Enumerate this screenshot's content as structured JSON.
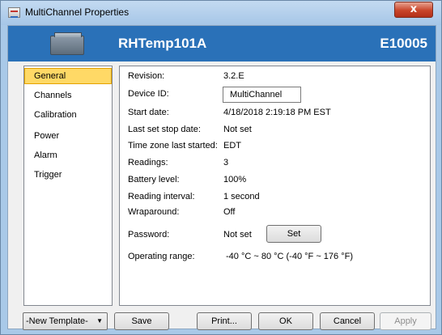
{
  "window": {
    "title": "MultiChannel Properties",
    "close_glyph": "x"
  },
  "header": {
    "device_name": "RHTemp101A",
    "serial": "E10005",
    "band_color": "#2a71b8"
  },
  "nav": {
    "items": [
      {
        "label": "General",
        "selected": true
      },
      {
        "label": "Channels",
        "selected": false
      },
      {
        "label": "Calibration",
        "selected": false
      },
      {
        "label": "Power",
        "selected": false
      },
      {
        "label": "Alarm",
        "selected": false
      },
      {
        "label": "Trigger",
        "selected": false
      }
    ],
    "selected_color": "#ffd966"
  },
  "general": {
    "revision_label": "Revision:",
    "revision_value": "3.2.E",
    "device_id_label": "Device ID:",
    "device_id_value": "MultiChannel",
    "start_date_label": "Start date:",
    "start_date_value": "4/18/2018 2:19:18 PM EST",
    "stop_date_label": "Last set stop date:",
    "stop_date_value": "Not set",
    "timezone_label": "Time zone last started:",
    "timezone_value": "EDT",
    "readings_label": "Readings:",
    "readings_value": "3",
    "battery_label": "Battery level:",
    "battery_value": "100%",
    "interval_label": "Reading interval:",
    "interval_value": "1 second",
    "wrap_label": "Wraparound:",
    "wrap_value": "Off",
    "password_label": "Password:",
    "password_value": "Not set",
    "password_button": "Set",
    "range_label": "Operating range:",
    "range_value": "-40 °C ~ 80 °C (-40 °F ~ 176 °F)"
  },
  "footer": {
    "template_select": "-New Template-",
    "save": "Save",
    "print": "Print...",
    "ok": "OK",
    "cancel": "Cancel",
    "apply": "Apply"
  }
}
